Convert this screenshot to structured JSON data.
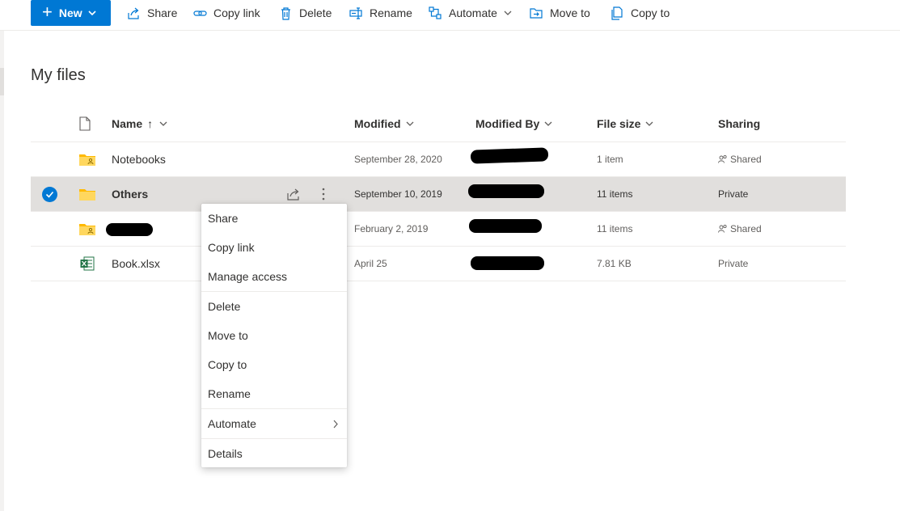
{
  "toolbar": {
    "new_label": "New",
    "share_label": "Share",
    "copy_link_label": "Copy link",
    "delete_label": "Delete",
    "rename_label": "Rename",
    "automate_label": "Automate",
    "move_to_label": "Move to",
    "copy_to_label": "Copy to"
  },
  "page": {
    "title": "My files"
  },
  "columns": {
    "name": "Name",
    "name_sort": "↑",
    "modified": "Modified",
    "modified_by": "Modified By",
    "file_size": "File size",
    "sharing": "Sharing"
  },
  "rows": [
    {
      "name": "Notebooks",
      "modified": "September 28, 2020",
      "file_size": "1 item",
      "sharing": "Shared",
      "icon": "shared-folder-icon"
    },
    {
      "name": "Others",
      "modified": "September 10, 2019",
      "file_size": "11 items",
      "sharing": "Private",
      "icon": "folder-icon",
      "selected": true
    },
    {
      "name": "",
      "modified": "February 2, 2019",
      "file_size": "11 items",
      "sharing": "Shared",
      "icon": "shared-folder-icon"
    },
    {
      "name": "Book.xlsx",
      "modified": "April 25",
      "file_size": "7.81 KB",
      "sharing": "Private",
      "icon": "excel-file-icon"
    }
  ],
  "context_menu": {
    "items": [
      "Share",
      "Copy link",
      "Manage access",
      "Delete",
      "Move to",
      "Copy to",
      "Rename",
      "Automate",
      "Details"
    ]
  },
  "colors": {
    "accent": "#0078d4",
    "selected_row": "#e1dfdd",
    "folder": "#ffb900",
    "excel": "#217346"
  }
}
